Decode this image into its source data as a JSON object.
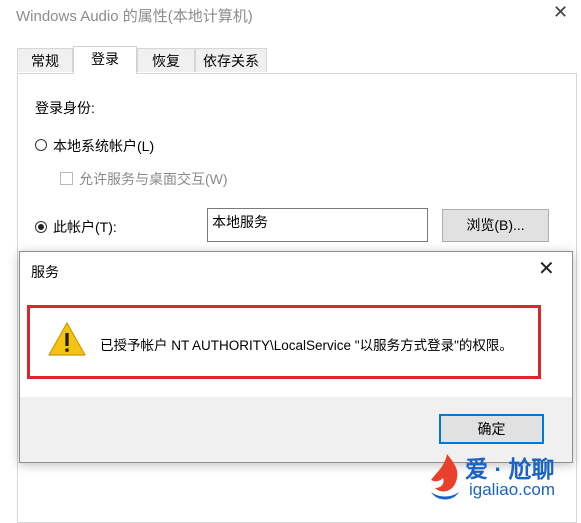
{
  "window": {
    "title": "Windows Audio 的属性(本地计算机)",
    "close_glyph": "✕"
  },
  "tabs": [
    {
      "label": "常规"
    },
    {
      "label": "登录"
    },
    {
      "label": "恢复"
    },
    {
      "label": "依存关系"
    }
  ],
  "logon": {
    "heading": "登录身份:",
    "local_system_label": "本地系统帐户(L)",
    "allow_interact_label": "允许服务与桌面交互(W)",
    "this_account_label": "此帐户(T):",
    "account_value": "本地服务",
    "browse_label": "浏览(B)..."
  },
  "dialog": {
    "title": "服务",
    "close_glyph": "✕",
    "message": "已授予帐户 NT AUTHORITY\\LocalService \"以服务方式登录\"的权限。",
    "ok_label": "确定",
    "icon": "warning-icon",
    "highlight_color": "#d9272b"
  },
  "watermark": {
    "brand_cn": "爱 · 尬聊",
    "brand_url": "igaliao.com"
  }
}
